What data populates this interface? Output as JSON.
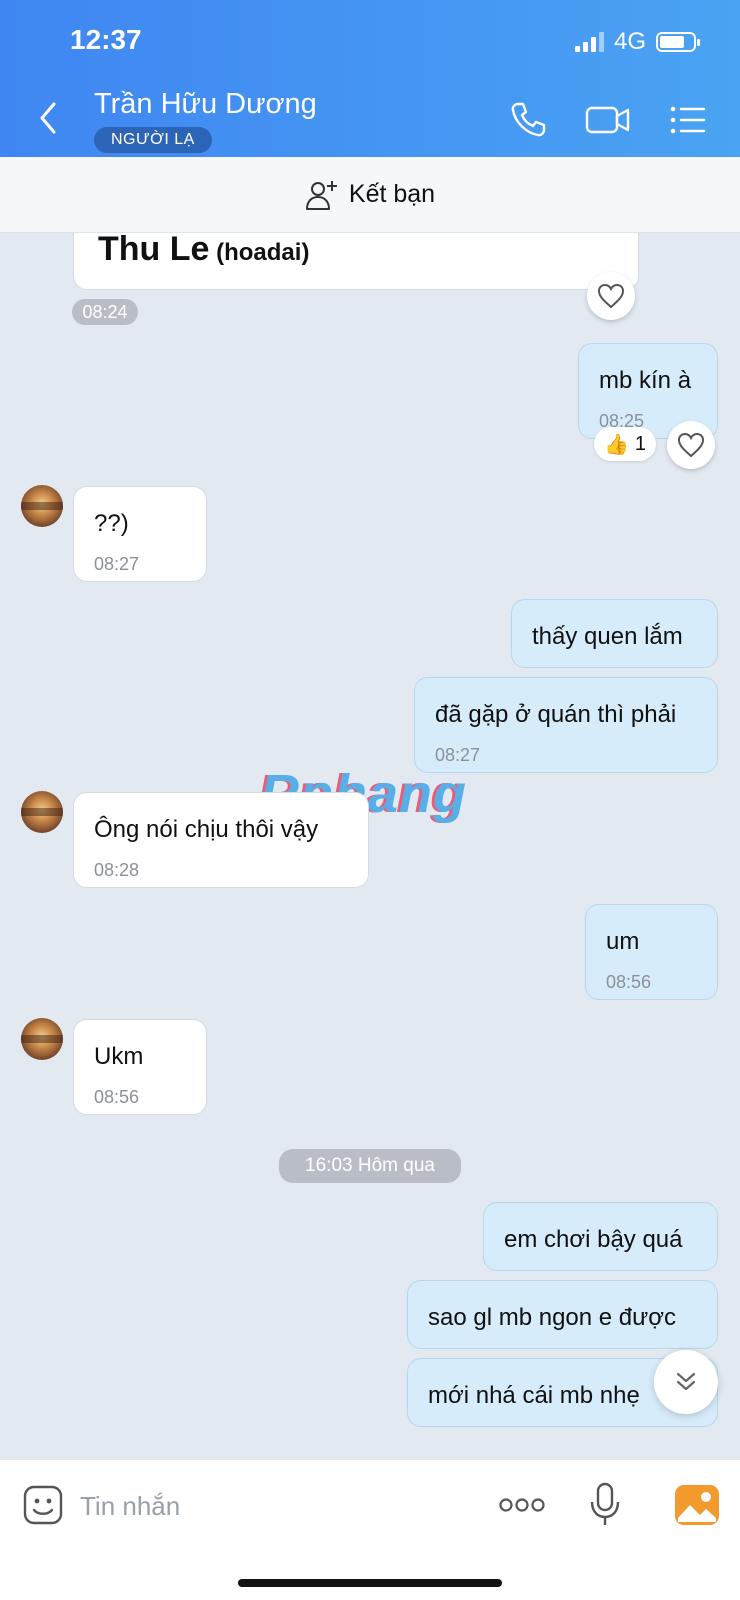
{
  "status_bar": {
    "time": "12:37",
    "network": "4G",
    "battery_level": 0.75
  },
  "header": {
    "contact_name": "Trần Hữu Dương",
    "badge": "NGƯỜI LẠ",
    "icons": [
      "back-icon",
      "phone-icon",
      "video-call-icon",
      "menu-list-icon"
    ]
  },
  "add_friend": {
    "label": "Kết bạn"
  },
  "messages": [
    {
      "side": "in",
      "card_name": "Thu Le",
      "card_handle": "(hoadai)",
      "time": "08:24"
    },
    {
      "side": "out",
      "text": "mb kín à",
      "time": "08:25",
      "reaction": {
        "emoji": "👍",
        "count": "1"
      }
    },
    {
      "side": "in",
      "text": "??)",
      "time": "08:27"
    },
    {
      "side": "out",
      "text": "thấy quen lắm"
    },
    {
      "side": "out",
      "text": "đã gặp ở quán thì phải",
      "time": "08:27"
    },
    {
      "side": "in",
      "text": "Ông nói chịu thôi vậy",
      "time": "08:28"
    },
    {
      "side": "out",
      "text": "um",
      "time": "08:56"
    },
    {
      "side": "in",
      "text": "Ukm",
      "time": "08:56"
    },
    {
      "side": "out",
      "text": "em chơi bậy quá"
    },
    {
      "side": "out",
      "text": "sao gl mb ngon e được"
    },
    {
      "side": "out",
      "text": "mới nhá cái mb nhẹ"
    }
  ],
  "date_separator": "16:03 Hôm qua",
  "watermark": "Rphang",
  "input": {
    "placeholder": "Tin nhắn",
    "value": ""
  },
  "colors": {
    "header_start": "#3f86f2",
    "header_end": "#4aa3f3",
    "outgoing_bubble": "#d7ecfb",
    "incoming_bubble": "#ffffff",
    "chat_bg": "#e2e9f1"
  }
}
